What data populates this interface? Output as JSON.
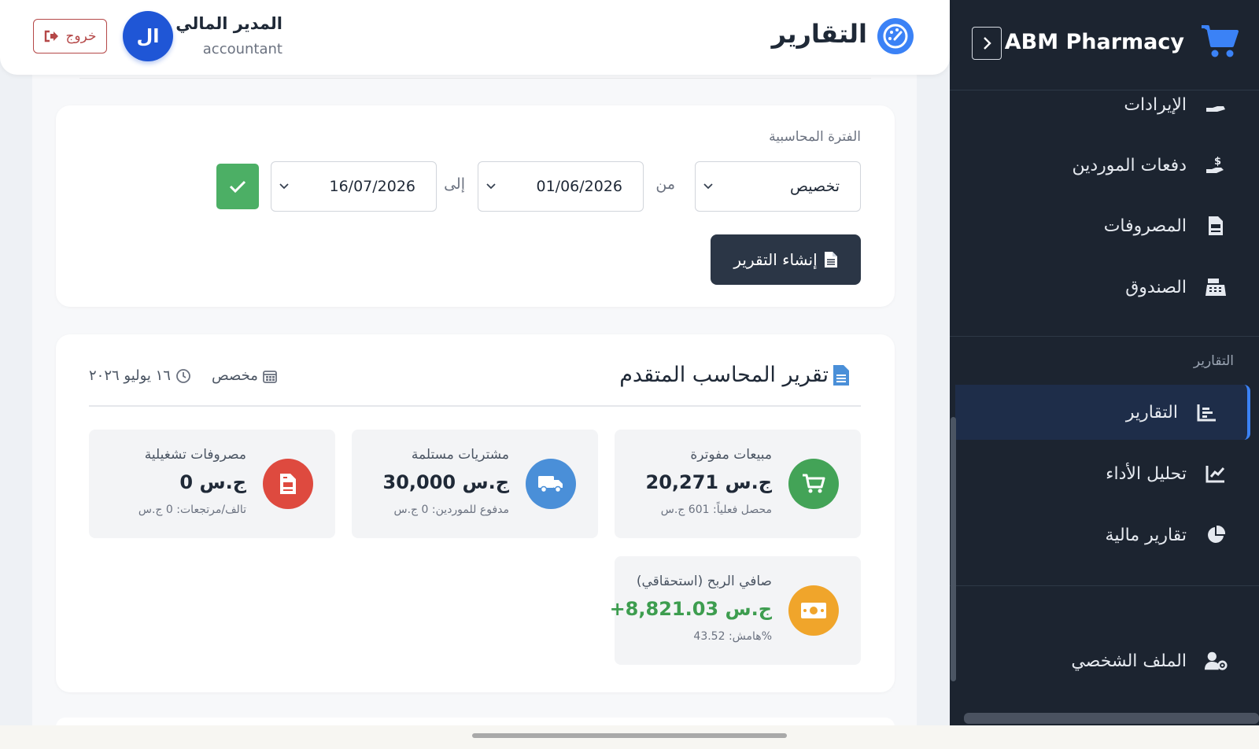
{
  "brand": {
    "name": "ABM Pharmacy"
  },
  "sidebar": {
    "items": [
      {
        "label": "الإيرادات",
        "icon": "hand-holding-icon"
      },
      {
        "label": "دفعات الموردين",
        "icon": "hand-holding-dollar-icon"
      },
      {
        "label": "المصروفات",
        "icon": "file-invoice-icon"
      },
      {
        "label": "الصندوق",
        "icon": "cash-register-icon"
      },
      {
        "label": "التقارير",
        "icon": "chart-bar-icon",
        "active": true
      },
      {
        "label": "تحليل الأداء",
        "icon": "chart-line-icon"
      },
      {
        "label": "تقارير مالية",
        "icon": "chart-pie-icon"
      },
      {
        "label": "الملف الشخصي",
        "icon": "user-gear-icon"
      }
    ],
    "section_reports": "التقارير"
  },
  "header": {
    "title": "التقارير",
    "user_name": "المدير المالي",
    "user_role": "accountant",
    "avatar_initials": "ال",
    "logout_label": "خروج"
  },
  "filter": {
    "period_label": "الفترة المحاسبية",
    "period_value": "تخصيص",
    "from_label": "من",
    "from_date": "01/06/2026",
    "to_label": "إلى",
    "to_date": "16/07/2026",
    "generate_label": "إنشاء التقرير"
  },
  "report": {
    "title": "تقرير المحاسب المتقدم",
    "type": "مخصص",
    "date": "١٦ يوليو ٢٠٢٦",
    "stats": {
      "sales": {
        "label": "مبيعات مفوترة",
        "value": "20,271 ج.س",
        "sub": "محصل فعلياً: 601 ج.س",
        "color": "#43a357"
      },
      "purchases": {
        "label": "مشتريات مستلمة",
        "value": "30,000 ج.س",
        "sub": "مدفوع للموردين: 0 ج.س",
        "color": "#4a8fd8"
      },
      "expenses": {
        "label": "مصروفات تشغيلية",
        "value": "0 ج.س",
        "sub": "تالف/مرتجعات: 0 ج.س",
        "color": "#de4a3f"
      },
      "profit": {
        "label": "صافي الربح (استحقاقي)",
        "value": "+8,821.03 ج.س",
        "sub": "هامش: 43.52%",
        "color": "#f0a52b"
      }
    }
  },
  "colors": {
    "accent": "#3b82f6",
    "sidebar_bg": "#1c2430",
    "success": "#4caf65",
    "danger": "#b54848"
  }
}
